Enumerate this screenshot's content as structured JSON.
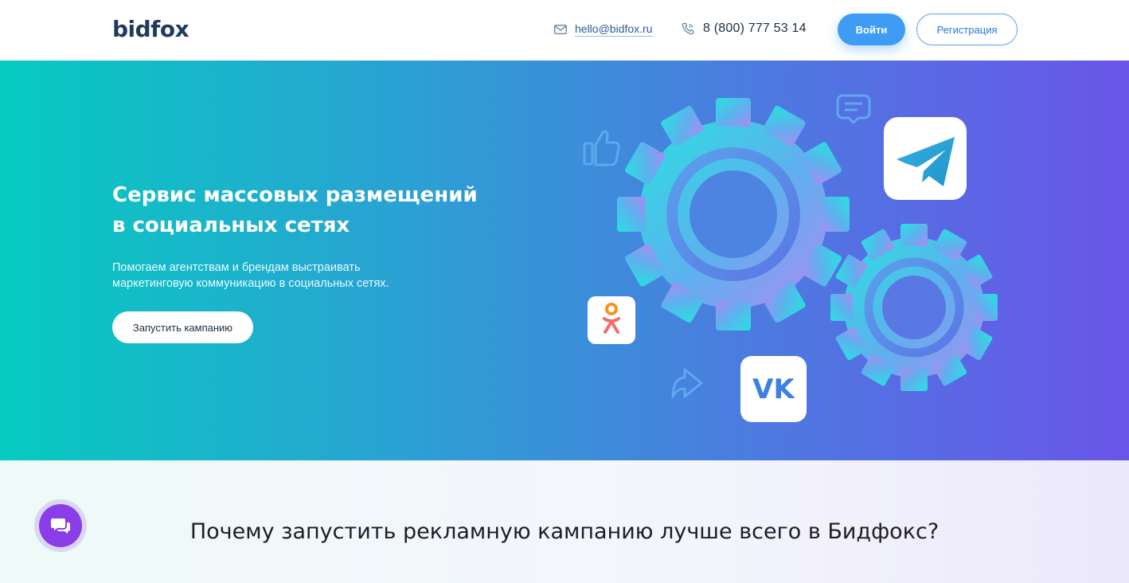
{
  "header": {
    "logo": "bidfox",
    "email": "hello@bidfox.ru",
    "phone": "8 (800) 777 53 14",
    "login_label": "Войти",
    "register_label": "Регистрация"
  },
  "hero": {
    "title_line1": "Сервис массовых размещений",
    "title_line2": "в социальных сетях",
    "subtitle_line1": "Помогаем агентствам и брендам выстраивать",
    "subtitle_line2": "маркетинговую коммуникацию в социальных сетях.",
    "cta_label": "Запустить кампанию",
    "vk_label": "VK"
  },
  "section": {
    "title": "Почему запустить рекламную кампанию лучше всего в Бидфокс?"
  },
  "colors": {
    "accent": "#3f9cf4",
    "gradient_start": "#06cbc0",
    "gradient_end": "#6a55e9",
    "chat": "#8a3de8"
  }
}
